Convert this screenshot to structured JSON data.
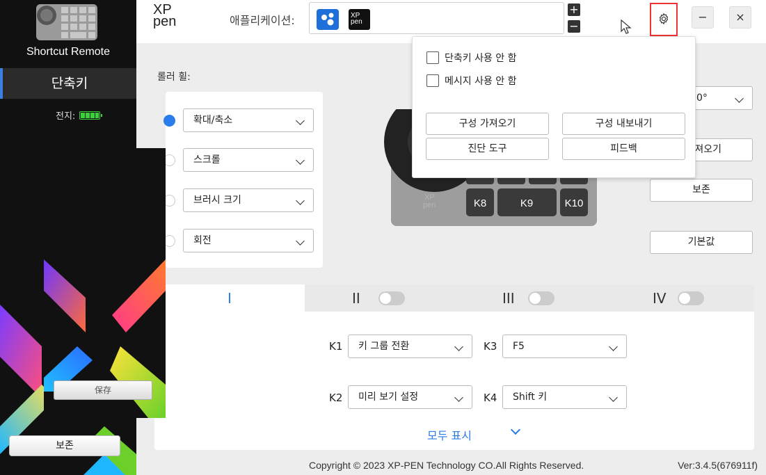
{
  "sidebar": {
    "device_name": "Shortcut Remote",
    "tab_label": "단축키",
    "battery_label": "전지:",
    "save_label": "보존"
  },
  "overlay": {
    "save_label": "保存"
  },
  "header": {
    "logo_line1": "XP",
    "logo_line2": "pen",
    "app_label": "애플리케이션:",
    "app2_line1": "XP",
    "app2_line2": "pen",
    "plus": "+",
    "minus": "−",
    "minimize": "−",
    "close": "×"
  },
  "main": {
    "roller_label": "롤러 휠:",
    "roller_options": [
      {
        "label": "확대/축소",
        "selected": true
      },
      {
        "label": "스크롤",
        "selected": false
      },
      {
        "label": "브러시 크기",
        "selected": false
      },
      {
        "label": "회전",
        "selected": false
      }
    ],
    "rotation_value": "0°",
    "import_partial": "져오기",
    "save_label": "보존",
    "default_label": "기본값",
    "device_keys": [
      "K8",
      "K9",
      "K10"
    ],
    "device_logo_line1": "XP",
    "device_logo_line2": "pen"
  },
  "popup": {
    "disable_shortcut": "단축키 사용 안 함",
    "disable_message": "메시지 사용 안 함",
    "import_config": "구성 가져오기",
    "export_config": "구성 내보내기",
    "diagnostic": "진단 도구",
    "feedback": "피드백"
  },
  "tabs": [
    {
      "label": "I",
      "active": true
    },
    {
      "label": "II",
      "active": false
    },
    {
      "label": "III",
      "active": false
    },
    {
      "label": "IV",
      "active": false
    }
  ],
  "keys": [
    {
      "label": "K1",
      "value": "키 그룹 전환"
    },
    {
      "label": "K3",
      "value": "F5"
    },
    {
      "label": "K2",
      "value": "미리 보기 설정"
    },
    {
      "label": "K4",
      "value": "Shift 키"
    }
  ],
  "show_all": "모두 표시",
  "footer": {
    "copyright": "Copyright © 2023  XP-PEN Technology CO.All Rights Reserved.",
    "version": "Ver:3.4.5(676911f)"
  },
  "colors": {
    "accent": "#2b7de9",
    "highlight_border": "#e33333",
    "battery": "#3ad13a"
  }
}
